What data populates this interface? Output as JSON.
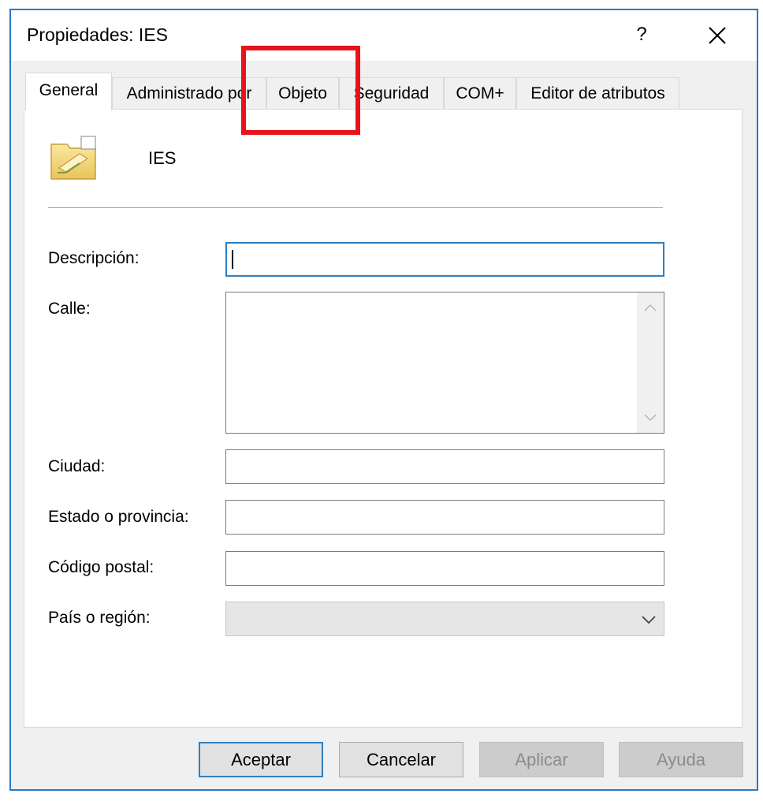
{
  "window": {
    "title": "Propiedades: IES",
    "help_label": "?"
  },
  "tabs": [
    {
      "label": "General",
      "active": true
    },
    {
      "label": "Administrado por",
      "active": false
    },
    {
      "label": "Objeto",
      "active": false
    },
    {
      "label": "Seguridad",
      "active": false
    },
    {
      "label": "COM+",
      "active": false
    },
    {
      "label": "Editor de atributos",
      "active": false
    }
  ],
  "general": {
    "object_name": "IES",
    "object_icon": "organizational-unit-icon",
    "fields": {
      "descripcion": {
        "label": "Descripción:",
        "value": ""
      },
      "calle": {
        "label": "Calle:",
        "value": ""
      },
      "ciudad": {
        "label": "Ciudad:",
        "value": ""
      },
      "estado": {
        "label": "Estado o provincia:",
        "value": ""
      },
      "codigo_postal": {
        "label": "Código postal:",
        "value": ""
      },
      "pais": {
        "label": "País o región:",
        "value": ""
      }
    }
  },
  "buttons": {
    "aceptar": "Aceptar",
    "cancelar": "Cancelar",
    "aplicar": "Aplicar",
    "ayuda": "Ayuda"
  },
  "colors": {
    "accent": "#2d7fbf",
    "highlight": "#e8121b"
  }
}
